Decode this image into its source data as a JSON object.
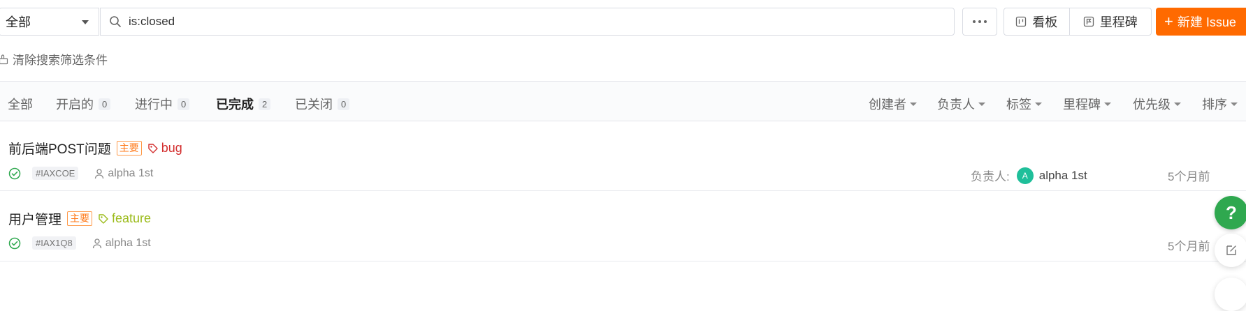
{
  "search": {
    "scope_value": "全部",
    "query_value": "is:closed",
    "more_label": "更多",
    "board_label": "看板",
    "milestone_label": "里程碑",
    "new_issue_label": "新建 Issue",
    "clear_filter_label": "清除搜索筛选条件"
  },
  "tabs": [
    {
      "label": "全部",
      "count": ""
    },
    {
      "label": "开启的",
      "count": "0"
    },
    {
      "label": "进行中",
      "count": "0"
    },
    {
      "label": "已完成",
      "count": "2",
      "active": true
    },
    {
      "label": "已关闭",
      "count": "0"
    }
  ],
  "filters": [
    "创建者",
    "负责人",
    "标签",
    "里程碑",
    "优先级",
    "排序"
  ],
  "issues": [
    {
      "title": "前后端POST问题",
      "priority": "主要",
      "label": "bug",
      "label_color": "#d32f2f",
      "ident": "#IAXCOE",
      "author": "alpha 1st",
      "assignee_prefix": "负责人:",
      "assignee_avatar": "A",
      "assignee": "alpha 1st",
      "time": "5个月前"
    },
    {
      "title": "用户管理",
      "priority": "主要",
      "label": "feature",
      "label_color": "#9bbb1a",
      "ident": "#IAX1Q8",
      "author": "alpha 1st",
      "time": "5个月前"
    }
  ],
  "floating": {
    "help_label": "?"
  },
  "colors": {
    "accent": "#ff6a00",
    "success": "#2fa84f",
    "avatar": "#1fbf9a"
  }
}
